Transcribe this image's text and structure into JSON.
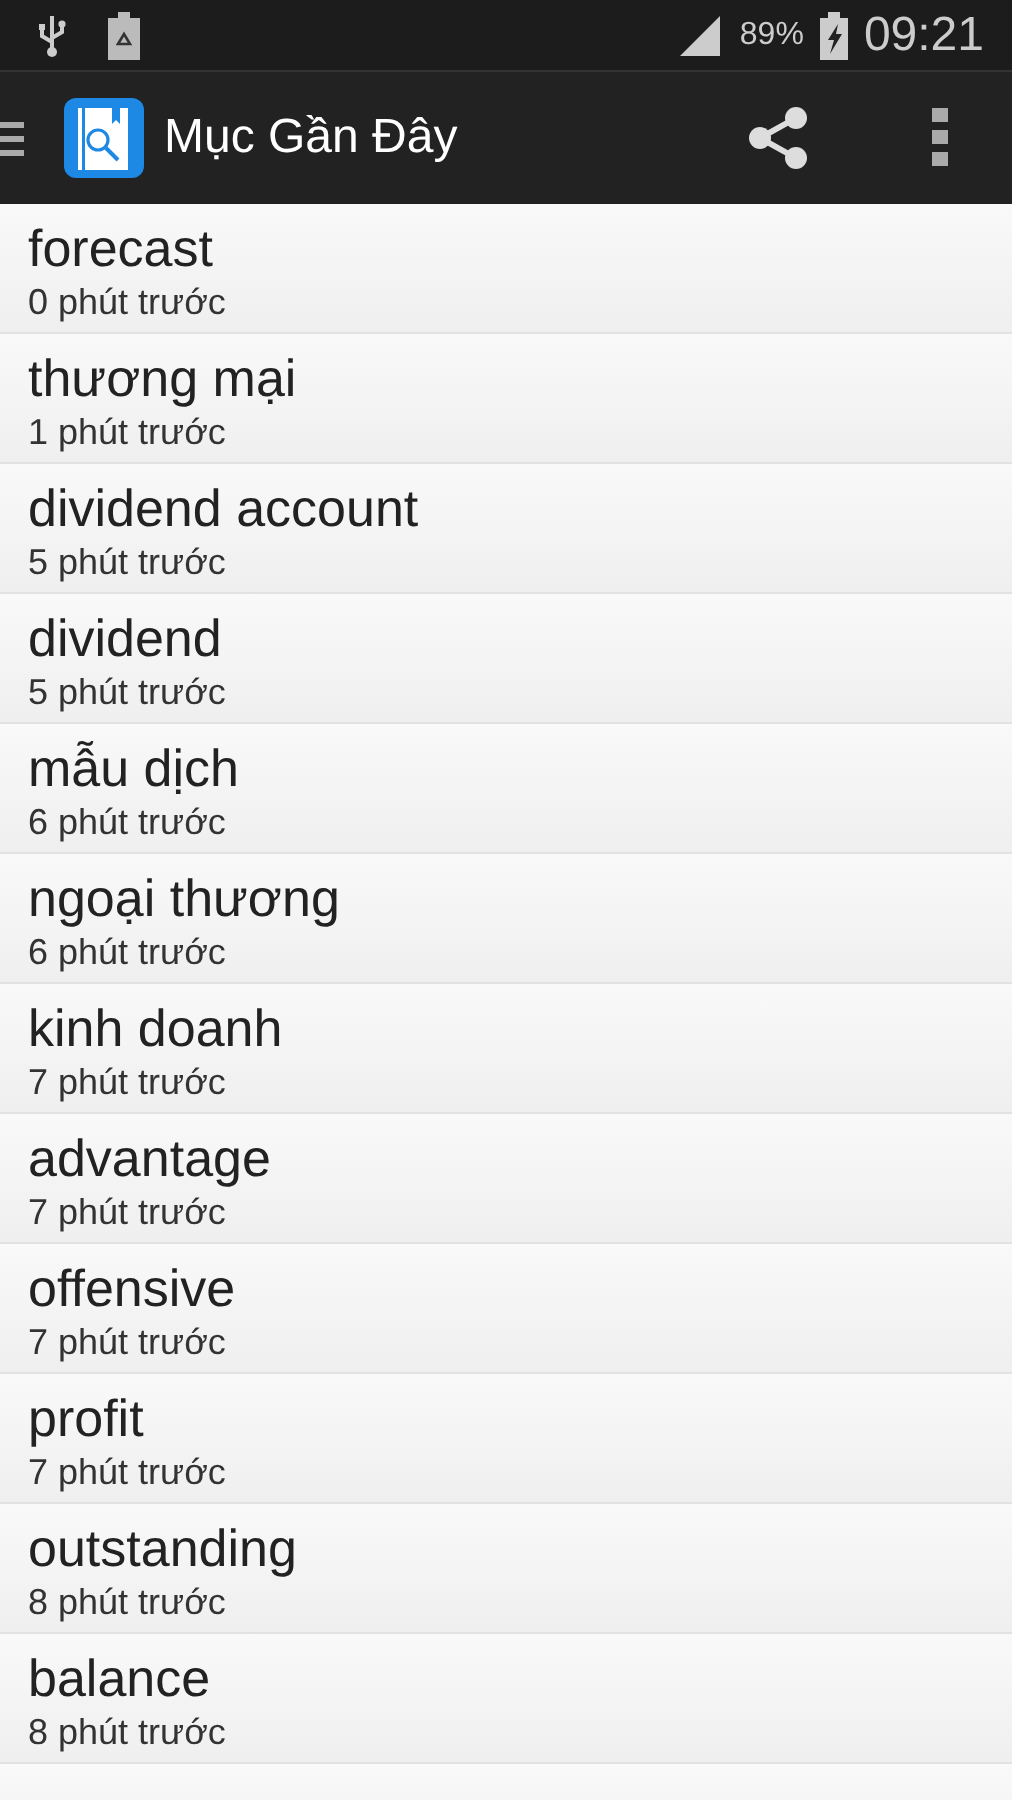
{
  "status_bar": {
    "battery": "89%",
    "time": "09:21"
  },
  "app_bar": {
    "title": "Mục Gần Đây"
  },
  "items": [
    {
      "word": "forecast",
      "time": "0 phút trước"
    },
    {
      "word": "thương mại",
      "time": "1 phút trước"
    },
    {
      "word": "dividend account",
      "time": "5 phút trước"
    },
    {
      "word": "dividend",
      "time": "5 phút trước"
    },
    {
      "word": "mẫu dịch",
      "time": "6 phút trước"
    },
    {
      "word": "ngoại thương",
      "time": "6 phút trước"
    },
    {
      "word": "kinh doanh",
      "time": "7 phút trước"
    },
    {
      "word": "advantage",
      "time": "7 phút trước"
    },
    {
      "word": "offensive",
      "time": "7 phút trước"
    },
    {
      "word": "profit",
      "time": "7 phút trước"
    },
    {
      "word": "outstanding",
      "time": "8 phút trước"
    },
    {
      "word": "balance",
      "time": "8 phút trước"
    }
  ]
}
